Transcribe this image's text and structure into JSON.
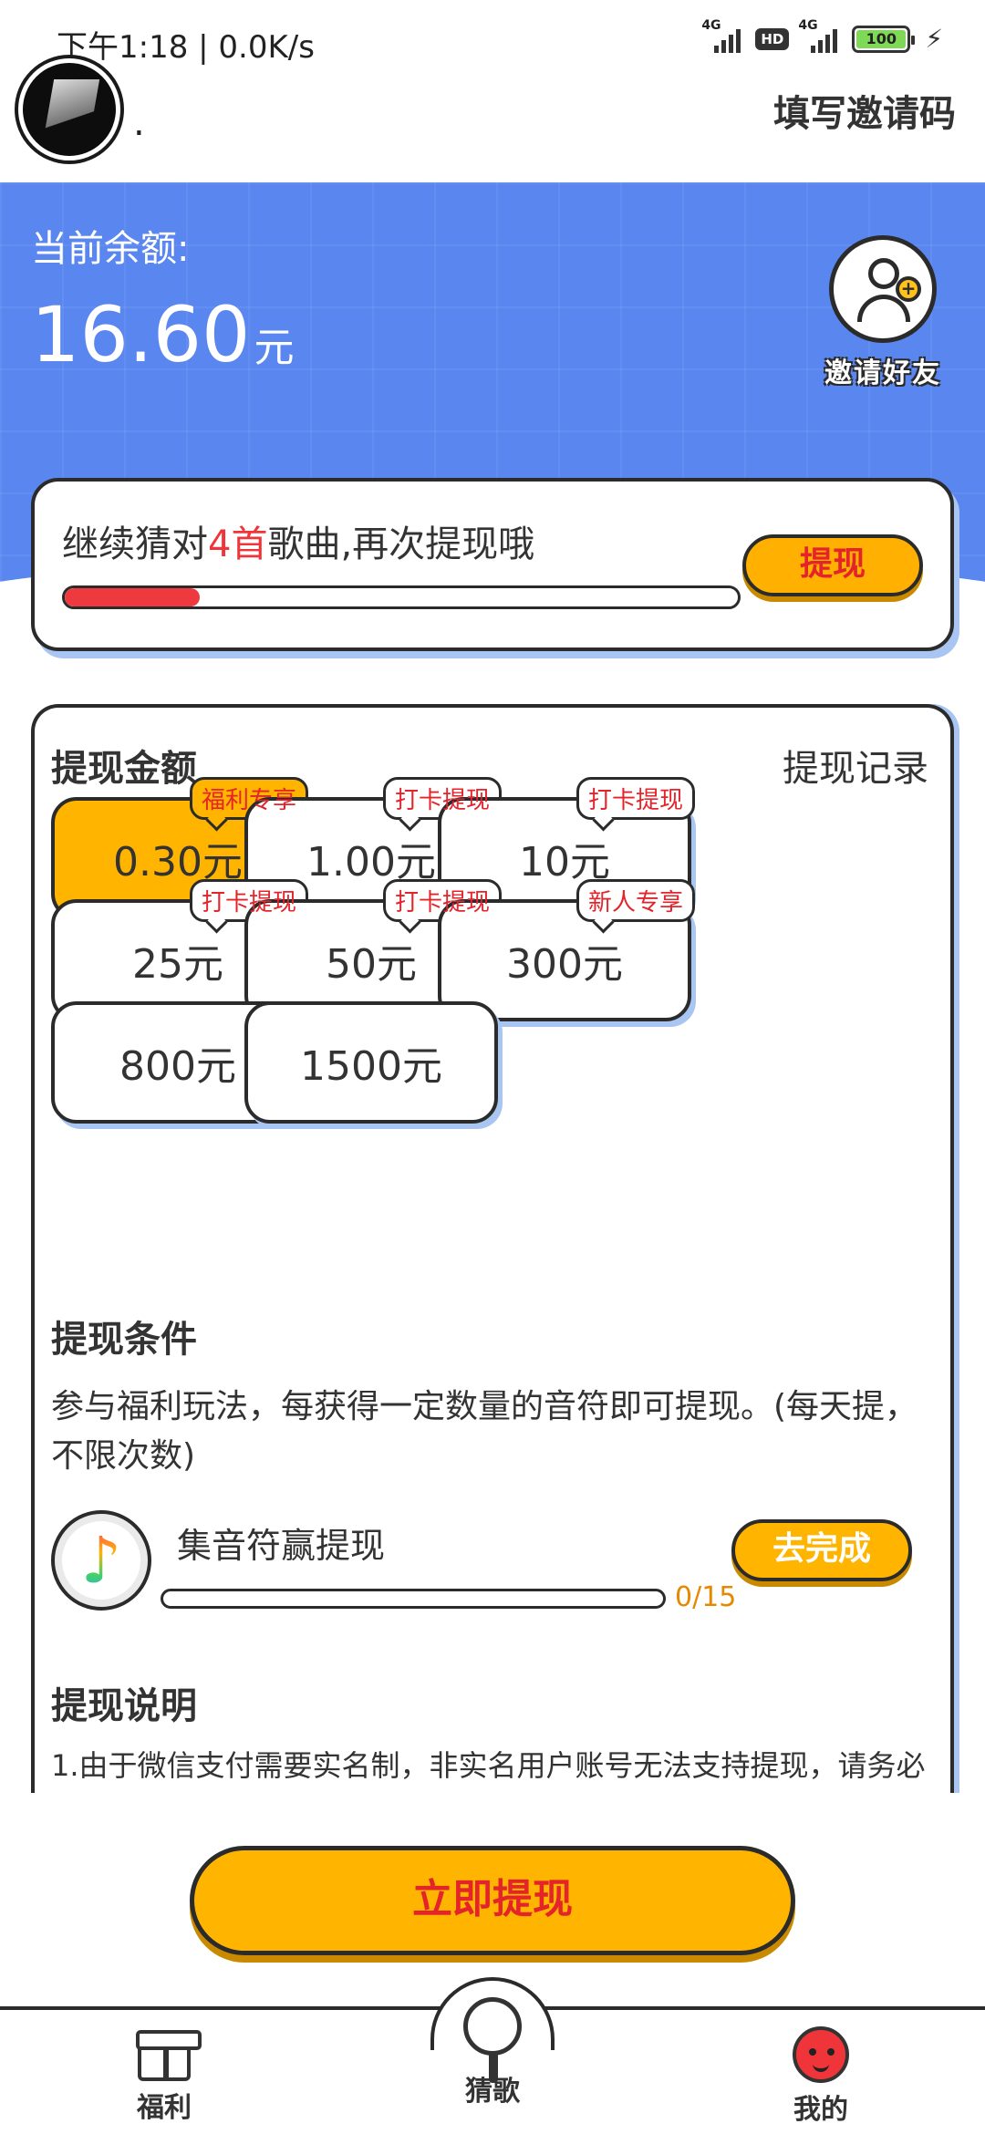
{
  "status_bar": {
    "time": "下午1:18 | 0.0K/s",
    "signal1_label": "4G",
    "hd": "HD",
    "signal2_label": "4G",
    "battery": "100"
  },
  "header": {
    "username": ".",
    "invite_code_link": "填写邀请码"
  },
  "balance": {
    "label": "当前余额:",
    "amount": "16.60",
    "unit": "元"
  },
  "invite_friend": {
    "label": "邀请好友"
  },
  "progress_card": {
    "text_prefix": "继续猜对",
    "highlight": "4首",
    "text_suffix": "歌曲,再次提现哦",
    "progress_fraction": 0.2,
    "button_label": "提现"
  },
  "withdraw": {
    "title": "提现金额",
    "records_link": "提现记录",
    "amounts": [
      {
        "label": "0.30元",
        "tag": "福利专享",
        "selected": true
      },
      {
        "label": "1.00元",
        "tag": "打卡提现",
        "selected": false
      },
      {
        "label": "10元",
        "tag": "打卡提现",
        "selected": false
      },
      {
        "label": "25元",
        "tag": "打卡提现",
        "selected": false
      },
      {
        "label": "50元",
        "tag": "打卡提现",
        "selected": false
      },
      {
        "label": "300元",
        "tag": "新人专享",
        "selected": false
      },
      {
        "label": "800元",
        "tag": "",
        "selected": false
      },
      {
        "label": "1500元",
        "tag": "",
        "selected": false
      }
    ]
  },
  "conditions": {
    "title": "提现条件",
    "text": "参与福利玩法，每获得一定数量的音符即可提现。(每天提，不限次数)"
  },
  "task": {
    "name": "集音符赢提现",
    "count": "0/15",
    "progress_fraction": 0,
    "button_label": "去完成"
  },
  "description": {
    "title": "提现说明",
    "line1": "1.由于微信支付需要实名制，非实名用户账号无法支持提现，请务必"
  },
  "main_button": "立即提现",
  "tabs": [
    {
      "label": "福利"
    },
    {
      "label": "猜歌"
    },
    {
      "label": "我的"
    }
  ]
}
